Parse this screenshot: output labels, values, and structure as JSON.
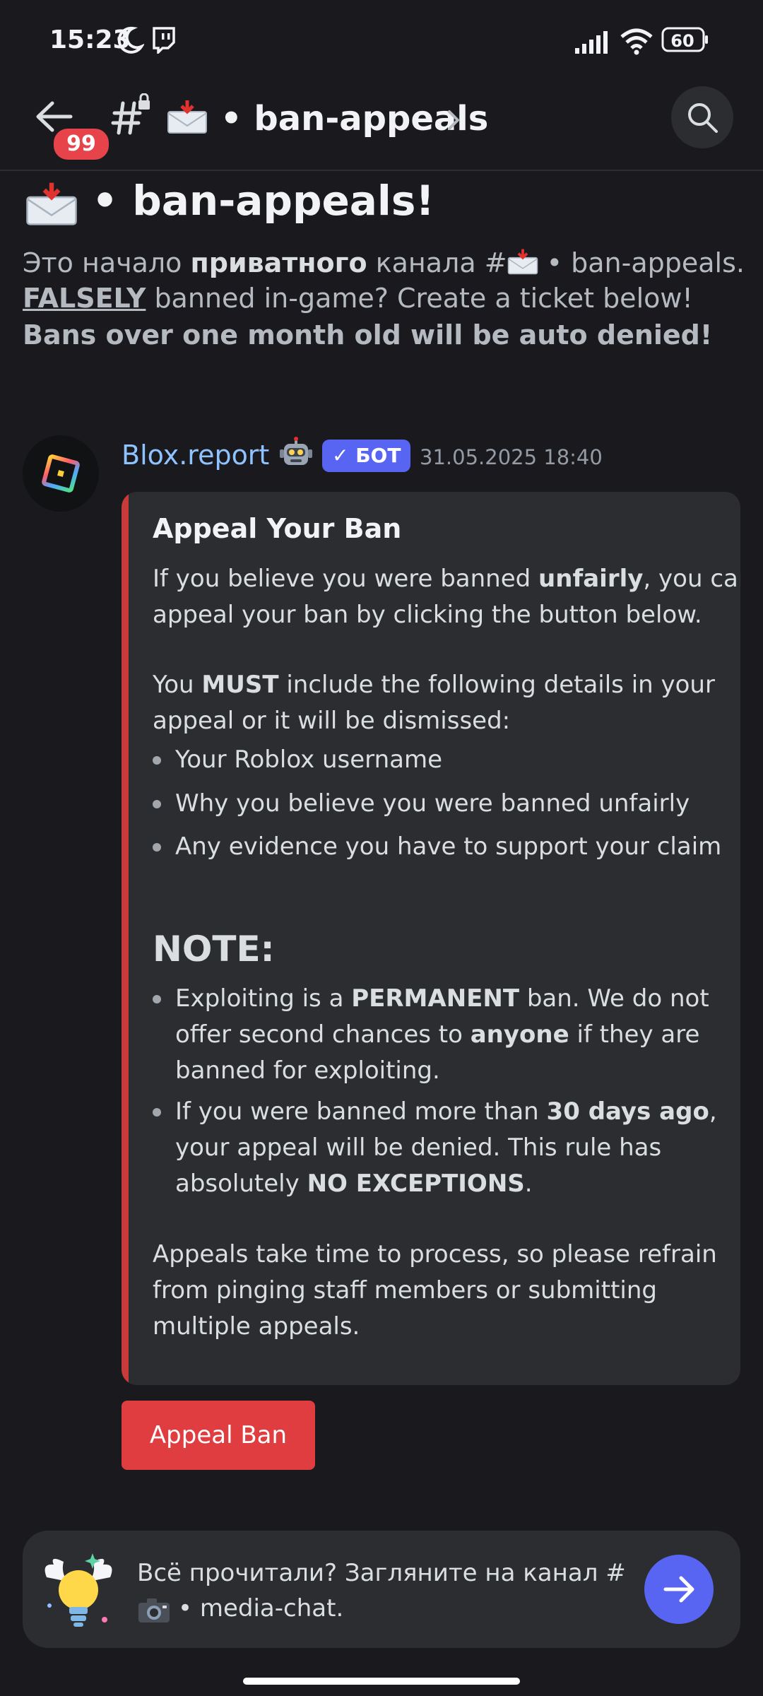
{
  "status": {
    "time": "15:23",
    "battery": "60"
  },
  "header": {
    "badge": "99",
    "channel": "• ban-appeals"
  },
  "intro": {
    "title": "• ban-appeals!",
    "line1_a": "Это начало ",
    "line1_b": "приватного",
    "line1_c": " канала #",
    "line1_d": " • ban-appeals.",
    "line2_a": "FALSELY",
    "line2_b": " banned in-game? Create a ticket below!",
    "line3": "Bans over one month old will be auto denied!"
  },
  "message": {
    "author": "Blox.report",
    "bot_tag": "✓ БОТ",
    "timestamp": "31.05.2025 18:40",
    "embed": {
      "title": "Appeal Your Ban",
      "p1_a": "If you believe you were banned ",
      "p1_b": "unfairly",
      "p1_c": ", you can",
      "p1_d": "appeal your ban by clicking the button below.",
      "p2_a": "You ",
      "p2_b": "MUST",
      "p2_c": " include the following details in your",
      "p2_d": "appeal or it will be dismissed:",
      "list": [
        "Your Roblox username",
        "Why you believe you were banned unfairly",
        "Any evidence you have to support your claim"
      ],
      "note_title": "NOTE:",
      "n1_a": "Exploiting is a ",
      "n1_b": "PERMANENT",
      "n1_c": " ban. We do not",
      "n1_d": "offer second chances to ",
      "n1_e": "anyone",
      "n1_f": " if they are",
      "n1_g": "banned for exploiting.",
      "n2_a": "If you were banned more than ",
      "n2_b": "30 days ago",
      "n2_c": ",",
      "n2_d": "your appeal will be denied. This rule has",
      "n2_e": "absolutely ",
      "n2_f": "NO EXCEPTIONS",
      "n2_g": ".",
      "f1": "Appeals take time to process, so please refrain",
      "f2": "from pinging staff members or submitting",
      "f3": "multiple appeals."
    },
    "button": "Appeal Ban"
  },
  "banner": {
    "line1": "Всё прочитали? Загляните на канал #",
    "line2": "• media-chat."
  },
  "colors": {
    "accent": "#5865f2",
    "danger": "#e03d40",
    "embed_bar": "#c93b3b",
    "link": "#8fc3ff"
  },
  "icons": [
    "moon-icon",
    "twitch-icon",
    "signal-icon",
    "wifi-icon",
    "battery-icon",
    "back-arrow-icon",
    "hash-lock-icon",
    "envelope-icon",
    "chevron-right-icon",
    "search-icon",
    "robot-icon",
    "lightbulb-icon",
    "camera-icon",
    "arrow-right-icon"
  ]
}
